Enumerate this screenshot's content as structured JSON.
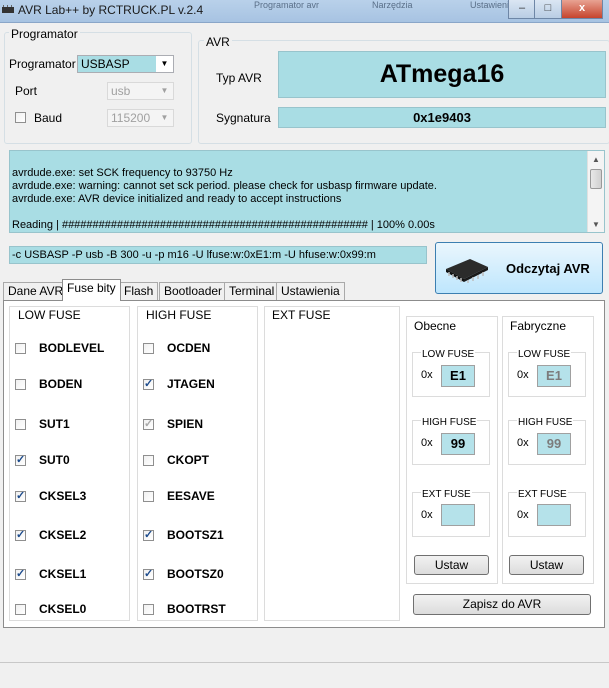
{
  "window": {
    "title": "AVR Lab++ by RCTRUCK.PL v.2.4",
    "bg_tabs": [
      "Programator avr",
      "Narzędzia",
      "Ustawienia"
    ],
    "buttons": {
      "minimize": "–",
      "maximize": "□",
      "close": "x"
    }
  },
  "programmer": {
    "group_label": "Programator",
    "programmer_label": "Programator",
    "programmer_value": "USBASP",
    "port_label": "Port",
    "port_value": "usb",
    "baud_label": "Baud",
    "baud_value": "115200"
  },
  "avr": {
    "group_label": "AVR",
    "type_label": "Typ AVR",
    "type_value": "ATmega16",
    "signature_label": "Sygnatura",
    "signature_value": "0x1e9403"
  },
  "log": {
    "lines": [
      "avrdude.exe: set SCK frequency to 93750 Hz",
      "avrdude.exe: warning: cannot set sck period. please check for usbasp firmware update.",
      "avrdude.exe: AVR device initialized and ready to accept instructions",
      "",
      "Reading | ################################################## | 100% 0.00s"
    ]
  },
  "command": "-c USBASP -P usb -B 300 -u  -p m16 -U lfuse:w:0xE1:m -U hfuse:w:0x99:m",
  "read_button": "Odczytaj AVR",
  "tabs": [
    "Dane AVR",
    "Fuse bity",
    "Flash",
    "Bootloader",
    "Terminal",
    "Ustawienia"
  ],
  "low_fuse": {
    "title": "LOW FUSE",
    "bits": [
      {
        "name": "BODLEVEL",
        "checked": false
      },
      {
        "name": "BODEN",
        "checked": false
      },
      {
        "name": "SUT1",
        "checked": false
      },
      {
        "name": "SUT0",
        "checked": true
      },
      {
        "name": "CKSEL3",
        "checked": true
      },
      {
        "name": "CKSEL2",
        "checked": true
      },
      {
        "name": "CKSEL1",
        "checked": true
      },
      {
        "name": "CKSEL0",
        "checked": false
      }
    ]
  },
  "high_fuse": {
    "title": "HIGH FUSE",
    "bits": [
      {
        "name": "OCDEN",
        "checked": false
      },
      {
        "name": "JTAGEN",
        "checked": true
      },
      {
        "name": "SPIEN",
        "checked": true,
        "disabled": true
      },
      {
        "name": "CKOPT",
        "checked": false
      },
      {
        "name": "EESAVE",
        "checked": false
      },
      {
        "name": "BOOTSZ1",
        "checked": true
      },
      {
        "name": "BOOTSZ0",
        "checked": true
      },
      {
        "name": "BOOTRST",
        "checked": false
      }
    ]
  },
  "ext_fuse": {
    "title": "EXT FUSE"
  },
  "current": {
    "title": "Obecne",
    "low_label": "LOW FUSE",
    "low_prefix": "0x",
    "low_value": "E1",
    "high_label": "HIGH FUSE",
    "high_prefix": "0x",
    "high_value": "99",
    "ext_label": "EXT FUSE",
    "ext_prefix": "0x",
    "ext_value": "",
    "set_button": "Ustaw"
  },
  "factory": {
    "title": "Fabryczne",
    "low_label": "LOW FUSE",
    "low_prefix": "0x",
    "low_value": "E1",
    "high_label": "HIGH FUSE",
    "high_prefix": "0x",
    "high_value": "99",
    "ext_label": "EXT FUSE",
    "ext_prefix": "0x",
    "ext_value": "",
    "set_button": "Ustaw"
  },
  "save_button": "Zapisz do AVR",
  "colors": {
    "cyan": "#a9dde4",
    "title_gradient": "#b9d1ea"
  }
}
